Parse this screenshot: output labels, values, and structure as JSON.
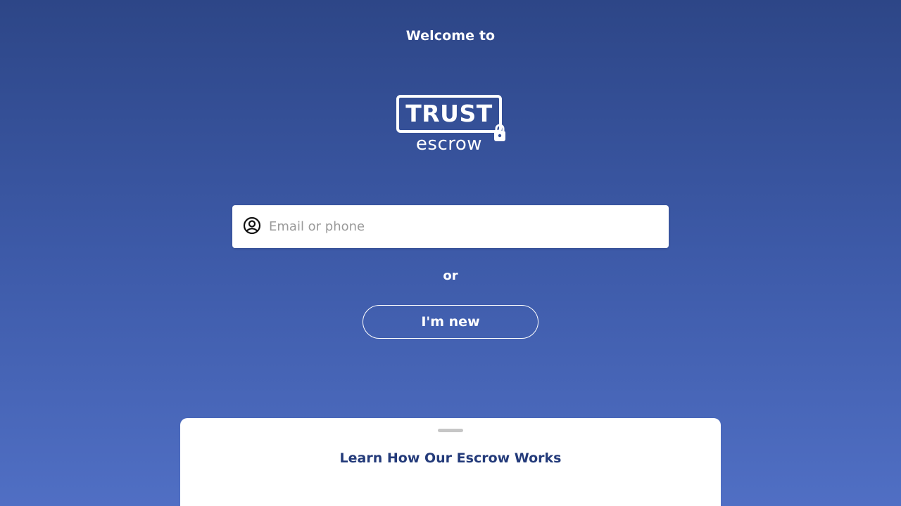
{
  "header": {
    "welcome_text": "Welcome to"
  },
  "logo": {
    "brand_text": "TRUST",
    "sub_text": "escrow"
  },
  "login": {
    "email_placeholder": "Email or phone",
    "email_value": "",
    "icon": "user-circle-icon"
  },
  "divider_text": "or",
  "new_button_label": "I'm new",
  "bottom_sheet": {
    "title": "Learn How Our Escrow Works"
  },
  "colors": {
    "background_top": "#2d4687",
    "background_bottom": "#506fc4",
    "sheet_title": "#243b7a",
    "white": "#ffffff"
  }
}
